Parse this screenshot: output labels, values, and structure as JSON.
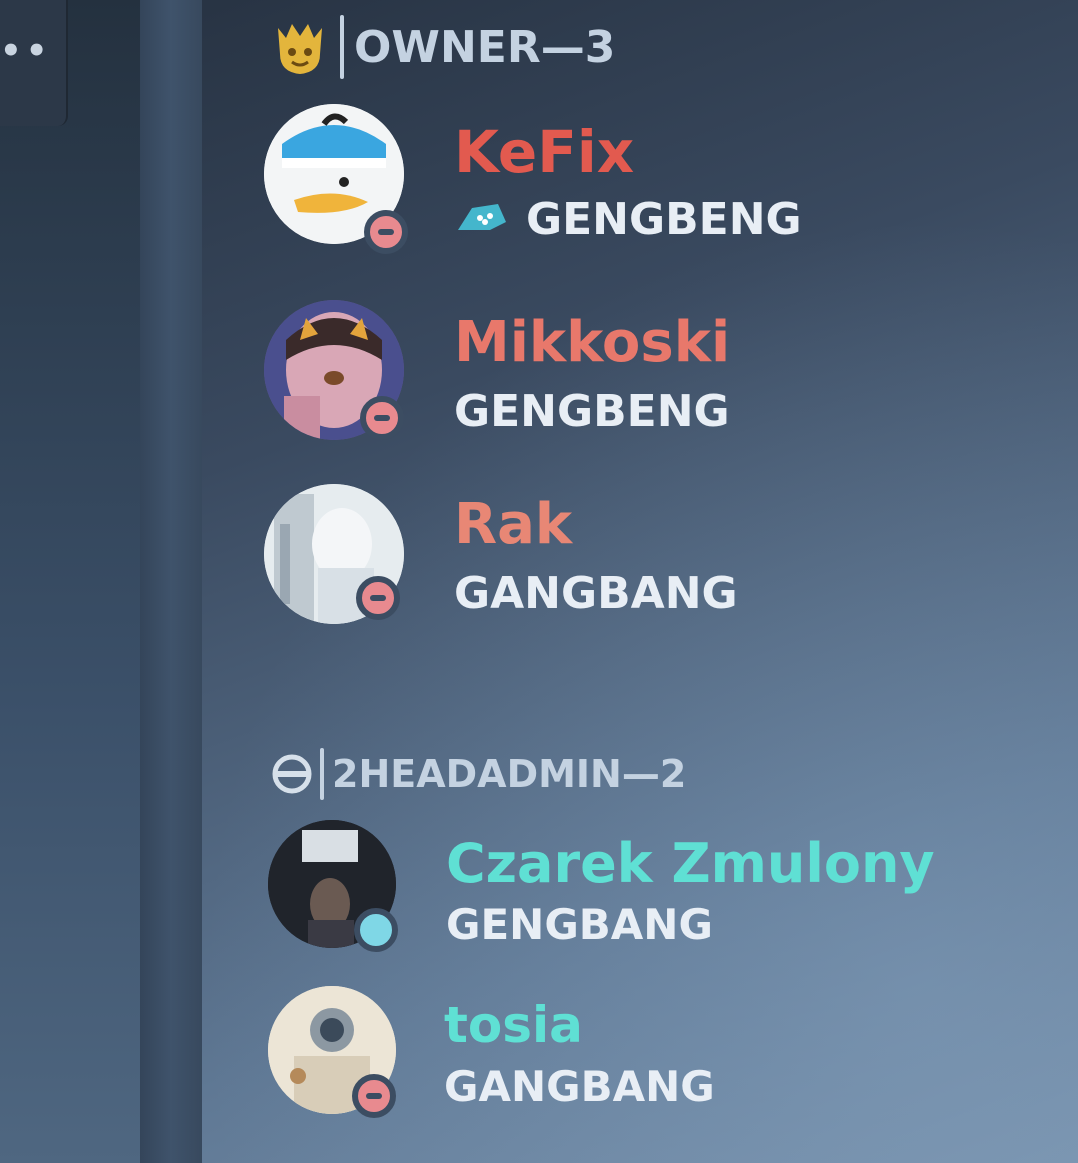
{
  "colors": {
    "owner_role": "#e25a4f",
    "owner_role_soft": "#e88775",
    "head_admin_role": "#5fe0d4",
    "activity_text": "#e8eef5",
    "header_text": "#c4d2e1",
    "dnd_status": "#e88a8f",
    "online_status": "#7fd7e6"
  },
  "sidebar": {
    "overflow_icon": "ellipsis-icon",
    "overflow_text": "••"
  },
  "groups": [
    {
      "icon": "crown-badge-icon",
      "label": "OWNER—3",
      "members": [
        {
          "name": "KeFix",
          "activity": "GENGBENG",
          "activity_icon": "game-controller-icon",
          "status": "dnd"
        },
        {
          "name": "Mikkoski",
          "activity": "GENGBENG",
          "status": "dnd"
        },
        {
          "name": "Rak",
          "activity": "GANGBANG",
          "status": "dnd"
        }
      ]
    },
    {
      "icon": "shield-badge-icon",
      "label": "2HEADADMIN—2",
      "members": [
        {
          "name": "Czarek Zmulony",
          "activity": "GENGBANG",
          "status": "online"
        },
        {
          "name": "tosia",
          "activity": "GANGBANG",
          "status": "dnd"
        }
      ]
    }
  ]
}
